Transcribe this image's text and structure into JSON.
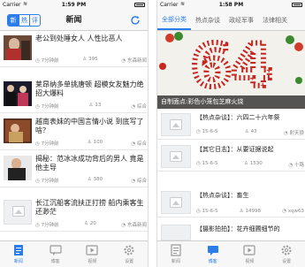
{
  "left": {
    "status": {
      "carrier": "Carrier",
      "time": "1:59 PM"
    },
    "segments": [
      "新",
      "热",
      "评"
    ],
    "title": "新闻",
    "news": [
      {
        "title": "老公到处睡女人 人性比恶人",
        "time": "7分钟前",
        "count": "395",
        "source": "东森新闻"
      },
      {
        "title": "莱昂纳多单挑唐顿 超模女友魅力绝招大爆料",
        "time": "7分钟前",
        "count": "13",
        "source": "综合"
      },
      {
        "title": "越南表妹的中国言情小说 到底写了啥？",
        "time": "7分钟前",
        "count": "100",
        "source": "综合"
      },
      {
        "title": "揭秘：范冰冰成功背后的男人 竟是他主导",
        "time": "7分钟前",
        "count": "380",
        "source": "综合"
      },
      {
        "title": "长江沉船客流扶正打捞 船内乘客生还渺茫",
        "time": "7分钟前",
        "count": "20",
        "source": "东森新闻"
      }
    ],
    "tabs": [
      "新闻",
      "博客",
      "视频",
      "设置"
    ]
  },
  "right": {
    "status": {
      "carrier": "Carrier",
      "time": "1:58 PM"
    },
    "channels": [
      "全部分类",
      "热点杂谈",
      "政经军事",
      "法律相关"
    ],
    "hero": {
      "caption": "自制面点:彩色小笼包芝麻火烧",
      "numbers": "64"
    },
    "feed": [
      {
        "title": "【热点杂谈】：六四二十六年祭",
        "date": "15-6-5",
        "count": "43",
        "author": "射天狼"
      },
      {
        "title": "【其它日志】：从要证据说起",
        "date": "15-6-5",
        "count": "1530",
        "author": "十路"
      },
      {
        "title": "【热点杂谈】：畜生",
        "date": "15-6-5",
        "count": "14998",
        "author": "xqw63"
      },
      {
        "title": "【摄影拍拍】：花卉细圃细节的",
        "date": "",
        "count": "",
        "author": ""
      }
    ],
    "tabs": [
      "新闻",
      "博客",
      "视频",
      "设置"
    ]
  },
  "colors": {
    "accent": "#2b7de9",
    "hero_red": "#c8261f",
    "hero_green": "#3c8a2e"
  }
}
